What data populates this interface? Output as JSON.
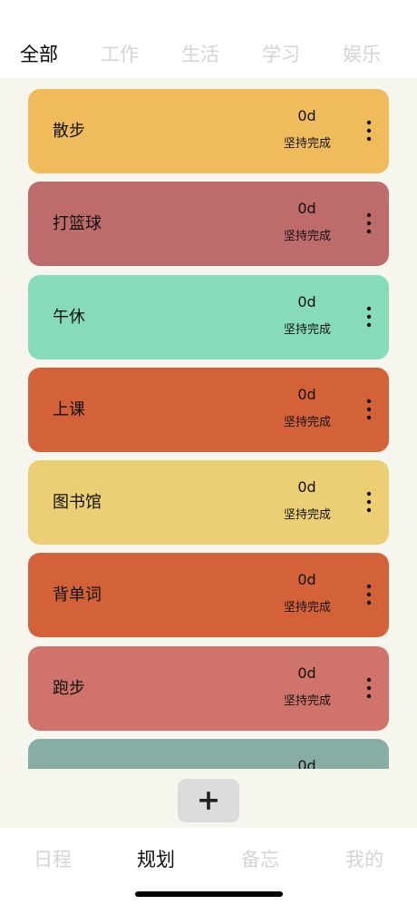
{
  "tabs": [
    {
      "label": "全部",
      "active": true
    },
    {
      "label": "工作",
      "active": false
    },
    {
      "label": "生活",
      "active": false
    },
    {
      "label": "学习",
      "active": false
    },
    {
      "label": "娱乐",
      "active": false
    }
  ],
  "cards": [
    {
      "title": "散步",
      "count": "0d",
      "subtitle": "坚持完成",
      "color": "#efbb5b"
    },
    {
      "title": "打篮球",
      "count": "0d",
      "subtitle": "坚持完成",
      "color": "#bd6b6b"
    },
    {
      "title": "午休",
      "count": "0d",
      "subtitle": "坚持完成",
      "color": "#86dbba"
    },
    {
      "title": "上课",
      "count": "0d",
      "subtitle": "坚持完成",
      "color": "#d46238"
    },
    {
      "title": "图书馆",
      "count": "0d",
      "subtitle": "坚持完成",
      "color": "#eccf74"
    },
    {
      "title": "背单词",
      "count": "0d",
      "subtitle": "坚持完成",
      "color": "#d46238"
    },
    {
      "title": "跑步",
      "count": "0d",
      "subtitle": "坚持完成",
      "color": "#d0746b"
    },
    {
      "title": "",
      "count": "0d",
      "subtitle": "",
      "color": "#88ada5"
    }
  ],
  "add_button": {
    "icon": "plus-icon"
  },
  "bottom_nav": [
    {
      "label": "日程",
      "active": false
    },
    {
      "label": "规划",
      "active": true
    },
    {
      "label": "备忘",
      "active": false
    },
    {
      "label": "我的",
      "active": false
    }
  ]
}
